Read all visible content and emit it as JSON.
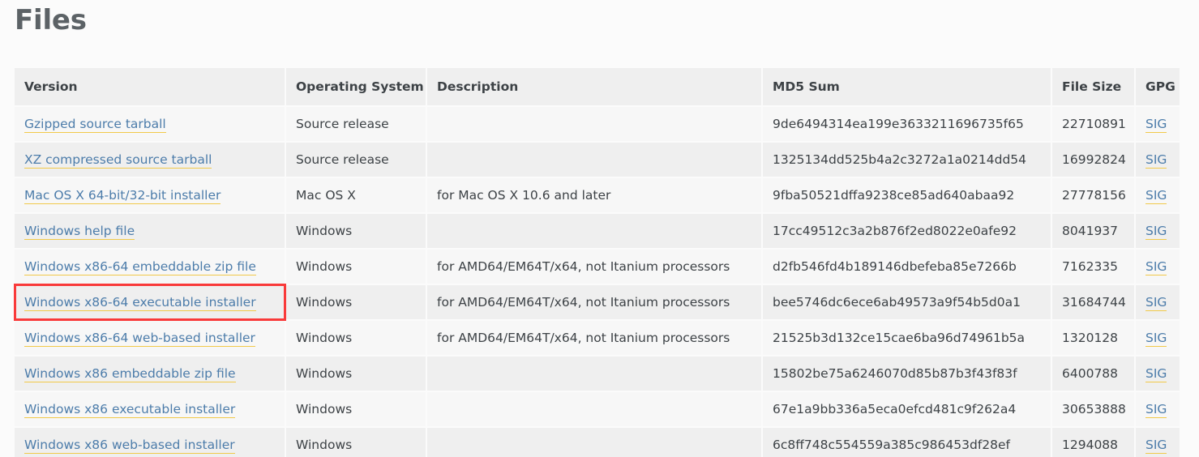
{
  "page": {
    "title": "Files"
  },
  "table": {
    "columns": [
      {
        "key": "version",
        "label": "Version"
      },
      {
        "key": "os",
        "label": "Operating System"
      },
      {
        "key": "description",
        "label": "Description"
      },
      {
        "key": "md5",
        "label": "MD5 Sum"
      },
      {
        "key": "filesize",
        "label": "File Size"
      },
      {
        "key": "gpg",
        "label": "GPG"
      }
    ],
    "rows": [
      {
        "version": "Gzipped source tarball",
        "os": "Source release",
        "description": "",
        "md5": "9de6494314ea199e3633211696735f65",
        "filesize": "22710891",
        "gpg": "SIG"
      },
      {
        "version": "XZ compressed source tarball",
        "os": "Source release",
        "description": "",
        "md5": "1325134dd525b4a2c3272a1a0214dd54",
        "filesize": "16992824",
        "gpg": "SIG"
      },
      {
        "version": "Mac OS X 64-bit/32-bit installer",
        "os": "Mac OS X",
        "description": "for Mac OS X 10.6 and later",
        "md5": "9fba50521dffa9238ce85ad640abaa92",
        "filesize": "27778156",
        "gpg": "SIG"
      },
      {
        "version": "Windows help file",
        "os": "Windows",
        "description": "",
        "md5": "17cc49512c3a2b876f2ed8022e0afe92",
        "filesize": "8041937",
        "gpg": "SIG"
      },
      {
        "version": "Windows x86-64 embeddable zip file",
        "os": "Windows",
        "description": "for AMD64/EM64T/x64, not Itanium processors",
        "md5": "d2fb546fd4b189146dbefeba85e7266b",
        "filesize": "7162335",
        "gpg": "SIG"
      },
      {
        "version": "Windows x86-64 executable installer",
        "os": "Windows",
        "description": "for AMD64/EM64T/x64, not Itanium processors",
        "md5": "bee5746dc6ece6ab49573a9f54b5d0a1",
        "filesize": "31684744",
        "gpg": "SIG"
      },
      {
        "version": "Windows x86-64 web-based installer",
        "os": "Windows",
        "description": "for AMD64/EM64T/x64, not Itanium processors",
        "md5": "21525b3d132ce15cae6ba96d74961b5a",
        "filesize": "1320128",
        "gpg": "SIG"
      },
      {
        "version": "Windows x86 embeddable zip file",
        "os": "Windows",
        "description": "",
        "md5": "15802be75a6246070d85b87b3f43f83f",
        "filesize": "6400788",
        "gpg": "SIG"
      },
      {
        "version": "Windows x86 executable installer",
        "os": "Windows",
        "description": "",
        "md5": "67e1a9bb336a5eca0efcd481c9f262a4",
        "filesize": "30653888",
        "gpg": "SIG"
      },
      {
        "version": "Windows x86 web-based installer",
        "os": "Windows",
        "description": "",
        "md5": "6c8ff748c554559a385c986453df28ef",
        "filesize": "1294088",
        "gpg": "SIG"
      }
    ]
  },
  "annotation": {
    "highlight_row_index": 5,
    "highlight_target": "Windows x86-64 executable installer",
    "color": "#f93a3a"
  },
  "colors": {
    "page_background": "#fbfbfb",
    "header_background": "#efefef",
    "row_odd_background": "#f7f7f7",
    "row_even_background": "#efefef",
    "link": "#4c7caa",
    "link_underline": "#f1c949",
    "text": "#3d4246",
    "title": "#5c6266"
  }
}
